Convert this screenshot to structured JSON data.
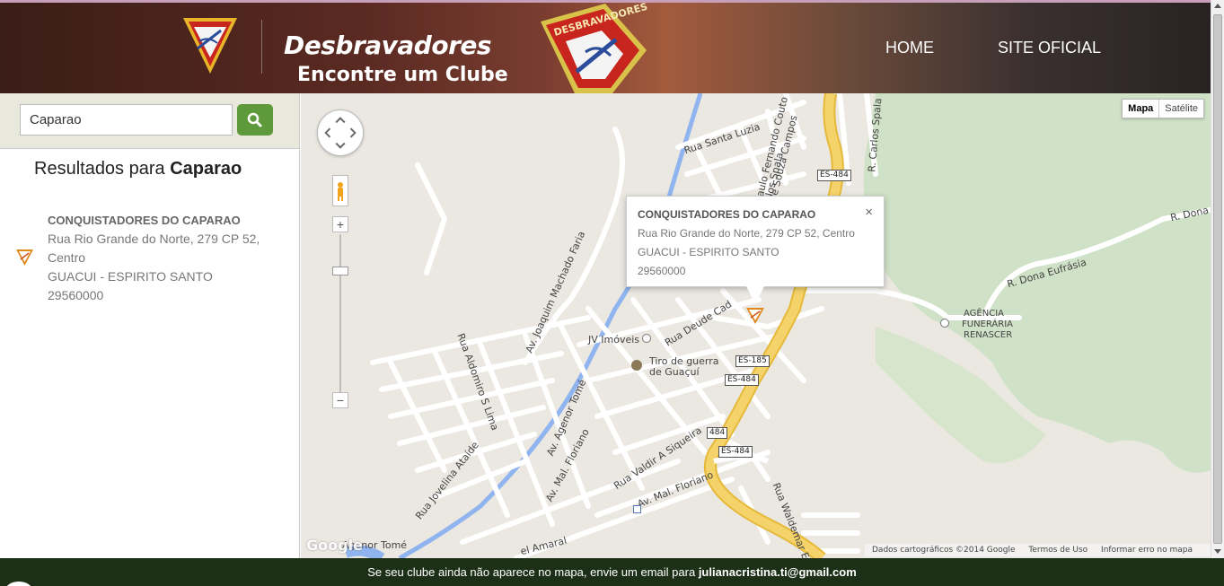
{
  "header": {
    "brand_title": "Desbravadores",
    "brand_subtitle": "Encontre um Clube",
    "nav": {
      "home": "HOME",
      "site": "SITE OFICIAL"
    },
    "patch_text": "DESBRAVADORES"
  },
  "search": {
    "value": "Caparao",
    "button_icon": "search-icon"
  },
  "results": {
    "title_prefix": "Resultados para",
    "query": "Caparao",
    "items": [
      {
        "name": "CONQUISTADORES DO CAPARAO",
        "address": "Rua Rio Grande do Norte, 279 CP 52, Centro",
        "city": "GUACUI - ESPIRITO SANTO",
        "zip": "29560000",
        "icon": "pathfinder-emblem-icon"
      }
    ]
  },
  "map": {
    "type_controls": {
      "map": "Mapa",
      "satellite": "Satélite"
    },
    "infowindow": {
      "name": "CONQUISTADORES DO CAPARAO",
      "address": "Rua Rio Grande do Norte, 279 CP 52, Centro",
      "city": "GUACUI - ESPIRITO SANTO",
      "zip": "29560000",
      "close": "×"
    },
    "labels": {
      "rua_santa_luzia": "Rua Santa Luzia",
      "paulo_fernando": "Paulo Fernando Couto",
      "de_souza_campos": "de Souza Campos",
      "carlos_spala_1": "R. Carlos Spala",
      "carlos_spala_2": "rlos Spala",
      "r_dona_1": "R. Dona",
      "r_dona_eufrasia": "R. Dona Eufrásia",
      "agencia": "AGÊNCIA",
      "funeraria": "FUNERÁRIA",
      "renascer": "RENASCER",
      "joaquim": "Av. Joaquim Machado Faria",
      "deude": "Rua Deude Cad",
      "jv_imoveis": "JV Imóveis",
      "tiro_1": "Tiro de guerra",
      "tiro_2": "de Guaçuí",
      "aldomiro": "Rua Aldomiro S Lima",
      "agenor": "Av. Agenor Tomé",
      "floriano_1": "Av. Mal. Floriano",
      "floriano_2": "Av. Mal. Floriano",
      "valdir": "Rua Valdir A Siqueira",
      "jovelina": "Rua Jovelina Ataíde",
      "waldemar": "Rua Waldemar Em",
      "agenor_tome": "Agenor Tomé",
      "amaral": "el Amaral"
    },
    "shields": {
      "es484_a": "ES-484",
      "es185": "ES-185",
      "es484_b": "ES-484",
      "r484": "484",
      "es484_c": "ES-484"
    },
    "google_logo": "Google",
    "attribution": {
      "data": "Dados cartográficos ©2014 Google",
      "terms": "Termos de Uso",
      "report": "Informar erro no mapa"
    }
  },
  "footer": {
    "text": "Se seu clube ainda não aparece no mapa, envie um email para",
    "email": "julianacristina.ti@gmail.com"
  },
  "colors": {
    "search_button": "#5e9a3b",
    "footer_bg": "#1c3018",
    "major_road": "#f4d36a",
    "river": "#8fb4f0",
    "park": "#cfe1c6"
  }
}
